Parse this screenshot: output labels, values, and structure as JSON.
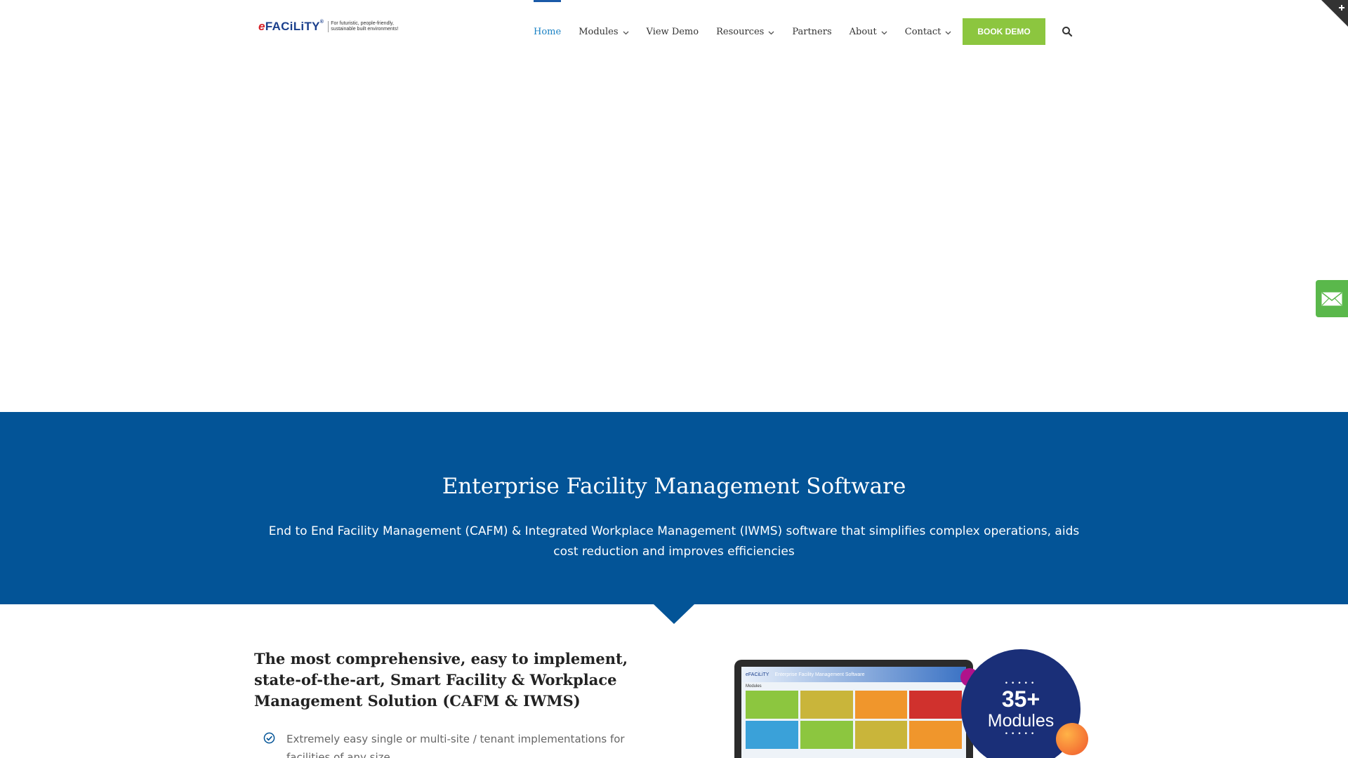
{
  "header": {
    "logo": {
      "brand_e": "e",
      "brand_rest": "FACiLiTY",
      "brand_mark": "®",
      "tagline_1": "For futuristic, people-friendly,",
      "tagline_2": "sustainable built environments!"
    },
    "nav": [
      {
        "label": "Home",
        "active": true,
        "dropdown": false
      },
      {
        "label": "Modules",
        "active": false,
        "dropdown": true
      },
      {
        "label": "View Demo",
        "active": false,
        "dropdown": false
      },
      {
        "label": "Resources",
        "active": false,
        "dropdown": true
      },
      {
        "label": "Partners",
        "active": false,
        "dropdown": false
      },
      {
        "label": "About",
        "active": false,
        "dropdown": true
      },
      {
        "label": "Contact",
        "active": false,
        "dropdown": true
      }
    ],
    "cta_label": "BOOK DEMO"
  },
  "band": {
    "title": "Enterprise Facility Management Software",
    "subtitle": "End to End Facility Management (CAFM) & Integrated Workplace Management (IWMS) software that simplifies complex operations, aids cost reduction and improves efficiencies"
  },
  "content": {
    "heading": "The most comprehensive, easy to implement, state-of-the-art, Smart Facility & Workplace Management Solution (CAFM & IWMS)",
    "features": [
      "Extremely easy single or multi-site / tenant implementations for facilities of any size"
    ]
  },
  "product": {
    "screen_brand": "eFACiLiTY",
    "screen_title": "Enterprise Facility Management Software",
    "screen_section": "Modules",
    "badge_number": "35+",
    "badge_label": "Modules",
    "tile_colors": [
      "#8cc63f",
      "#c9b53a",
      "#f0962c",
      "#d0312d",
      "#3aa1d9",
      "#8cc63f",
      "#c9b53a",
      "#f0962c"
    ]
  },
  "colors": {
    "brand_blue": "#035497",
    "accent_green": "#8cc63f",
    "mail_green": "#5ab84b",
    "nav_active": "#1a82c4"
  },
  "icons": {
    "search": "search-icon",
    "mail": "mail-icon",
    "check": "check-circle-icon",
    "chevron": "chevron-down-icon",
    "corner": "plus-icon"
  }
}
